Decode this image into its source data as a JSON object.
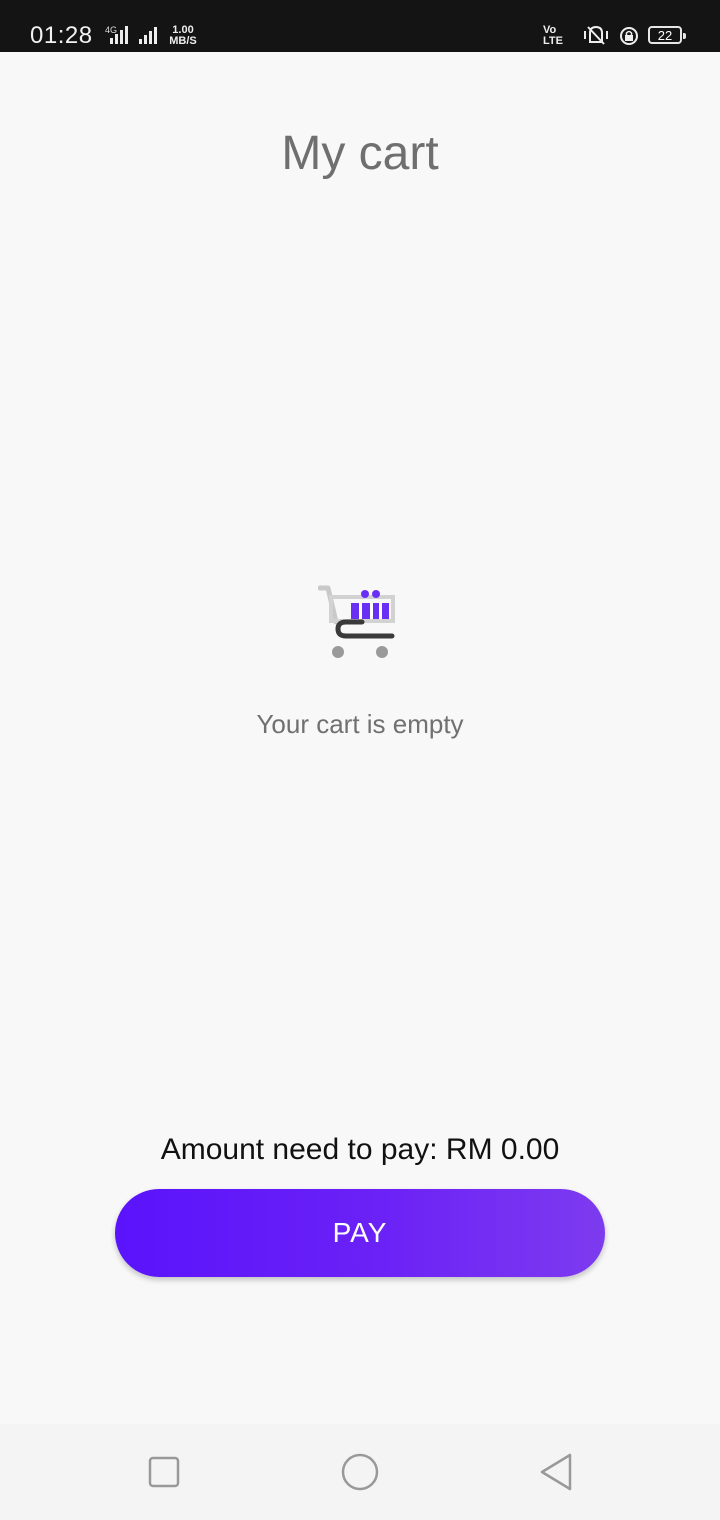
{
  "status_bar": {
    "time": "01:28",
    "network_type": "4G",
    "speed_value": "1.00",
    "speed_unit": "MB/S",
    "volte_top": "Vo",
    "volte_bottom": "LTE",
    "battery": "22"
  },
  "header": {
    "title": "My cart"
  },
  "empty_state": {
    "icon": "shopping-cart-icon",
    "message": "Your cart is empty"
  },
  "footer": {
    "amount_label": "Amount need to pay:",
    "amount_value": "RM 0.00",
    "pay_button_label": "PAY"
  },
  "nav_bar": {
    "recent_icon": "square-icon",
    "home_icon": "circle-icon",
    "back_icon": "triangle-back-icon"
  },
  "colors": {
    "accent_start": "#5a13fb",
    "accent_end": "#7d3bef",
    "title_text": "#6f6f6f",
    "background": "#f8f8f8"
  }
}
